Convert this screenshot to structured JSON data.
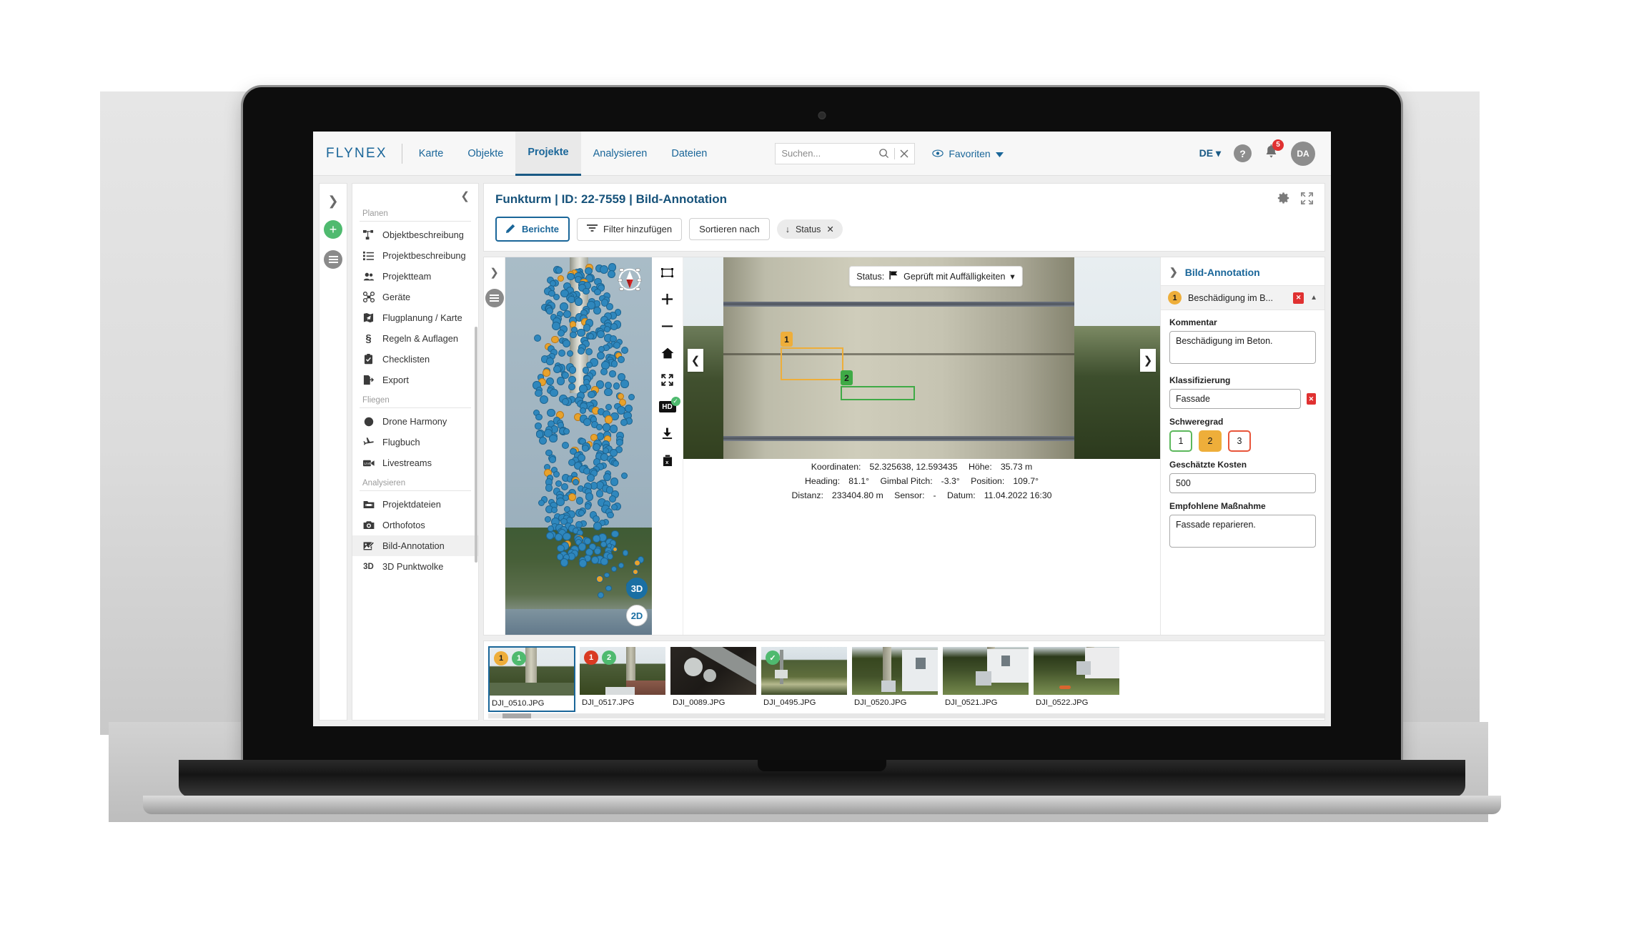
{
  "header": {
    "logo": "FLYNEX",
    "nav": [
      {
        "label": "Karte",
        "active": false
      },
      {
        "label": "Objekte",
        "active": false
      },
      {
        "label": "Projekte",
        "active": true
      },
      {
        "label": "Analysieren",
        "active": false
      },
      {
        "label": "Dateien",
        "active": false
      }
    ],
    "search_placeholder": "Suchen...",
    "favorites_label": "Favoriten",
    "language": "DE",
    "help": "?",
    "notification_count": "5",
    "avatar_initials": "DA"
  },
  "sidebar": {
    "groups": [
      {
        "title": "Planen",
        "items": [
          {
            "label": "Objektbeschreibung",
            "icon": "sitemap-icon"
          },
          {
            "label": "Projektbeschreibung",
            "icon": "list-icon"
          },
          {
            "label": "Projektteam",
            "icon": "team-icon"
          },
          {
            "label": "Geräte",
            "icon": "drone-icon"
          },
          {
            "label": "Flugplanung / Karte",
            "icon": "flight-map-icon"
          },
          {
            "label": "Regeln & Auflagen",
            "icon": "paragraph-icon"
          },
          {
            "label": "Checklisten",
            "icon": "clipboard-check-icon"
          },
          {
            "label": "Export",
            "icon": "export-icon"
          }
        ]
      },
      {
        "title": "Fliegen",
        "items": [
          {
            "label": "Drone Harmony",
            "icon": "circle-icon"
          },
          {
            "label": "Flugbuch",
            "icon": "plane-icon"
          },
          {
            "label": "Livestreams",
            "icon": "live-camera-icon"
          }
        ]
      },
      {
        "title": "Analysieren",
        "items": [
          {
            "label": "Projektdateien",
            "icon": "folder-icon"
          },
          {
            "label": "Orthofotos",
            "icon": "camera-icon"
          },
          {
            "label": "Bild-Annotation",
            "icon": "image-edit-icon",
            "active": true
          },
          {
            "label": "3D Punktwolke",
            "icon": "3d-icon"
          }
        ]
      }
    ]
  },
  "page": {
    "title": "Funkturm | ID: 22-7559 | Bild-Annotation",
    "toolbar": {
      "reports_label": "Berichte",
      "add_filter_label": "Filter hinzufügen",
      "sort_by_label": "Sortieren nach",
      "status_chip_label": "Status"
    }
  },
  "viewer": {
    "status_prefix": "Status:",
    "status_value": "Geprüft mit Auffälligkeiten",
    "map_mode_3d": "3D",
    "map_mode_2d": "2D",
    "annotation_markers": [
      {
        "number": "1",
        "color": "#eeae3a"
      },
      {
        "number": "2",
        "color": "#3faa46"
      }
    ],
    "metadata": {
      "coordinates_label": "Koordinaten:",
      "coordinates_value": "52.325638, 12.593435",
      "height_label": "Höhe:",
      "height_value": "35.73 m",
      "heading_label": "Heading:",
      "heading_value": "81.1°",
      "gimbal_label": "Gimbal Pitch:",
      "gimbal_value": "-3.3°",
      "position_label": "Position:",
      "position_value": "109.7°",
      "distance_label": "Distanz:",
      "distance_value": "233404.80 m",
      "sensor_label": "Sensor:",
      "sensor_value": "-",
      "date_label": "Datum:",
      "date_value": "11.04.2022 16:30"
    },
    "tools": [
      "crop-icon",
      "zoom-in-icon",
      "zoom-out-icon",
      "home-icon",
      "fullscreen-icon",
      "hd-icon",
      "download-icon",
      "delete-icon"
    ]
  },
  "annotation_panel": {
    "title": "Bild-Annotation",
    "item_number": "1",
    "item_title": "Beschädigung im B...",
    "comment_label": "Kommentar",
    "comment_value": "Beschädigung im Beton.",
    "classification_label": "Klassifizierung",
    "classification_value": "Fassade",
    "severity_label": "Schweregrad",
    "severity_options": [
      "1",
      "2",
      "3"
    ],
    "severity_selected": "2",
    "cost_label": "Geschätzte Kosten",
    "cost_value": "500",
    "measure_label": "Empfohlene Maßnahme",
    "measure_value": "Fassade reparieren."
  },
  "filmstrip": [
    {
      "name": "DJI_0510.JPG",
      "selected": true,
      "badges": [
        {
          "text": "1",
          "type": "orange"
        },
        {
          "text": "1",
          "type": "green"
        }
      ],
      "scene": "tower-field"
    },
    {
      "name": "DJI_0517.JPG",
      "selected": false,
      "badges": [
        {
          "text": "1",
          "type": "red"
        },
        {
          "text": "2",
          "type": "green"
        }
      ],
      "scene": "tower-roof"
    },
    {
      "name": "DJI_0089.JPG",
      "selected": false,
      "badges": [],
      "scene": "dark-detail"
    },
    {
      "name": "DJI_0495.JPG",
      "selected": false,
      "badges": [
        {
          "text": "✓",
          "type": "green-check"
        }
      ],
      "scene": "mast-aerial"
    },
    {
      "name": "DJI_0520.JPG",
      "selected": false,
      "badges": [],
      "scene": "building-a"
    },
    {
      "name": "DJI_0521.JPG",
      "selected": false,
      "badges": [],
      "scene": "building-b"
    },
    {
      "name": "DJI_0522.JPG",
      "selected": false,
      "badges": [],
      "scene": "building-c"
    }
  ],
  "colors": {
    "brand_blue": "#1a6699",
    "accent_orange": "#eeae3a",
    "accent_green": "#4fba6f",
    "accent_red": "#e03131"
  }
}
